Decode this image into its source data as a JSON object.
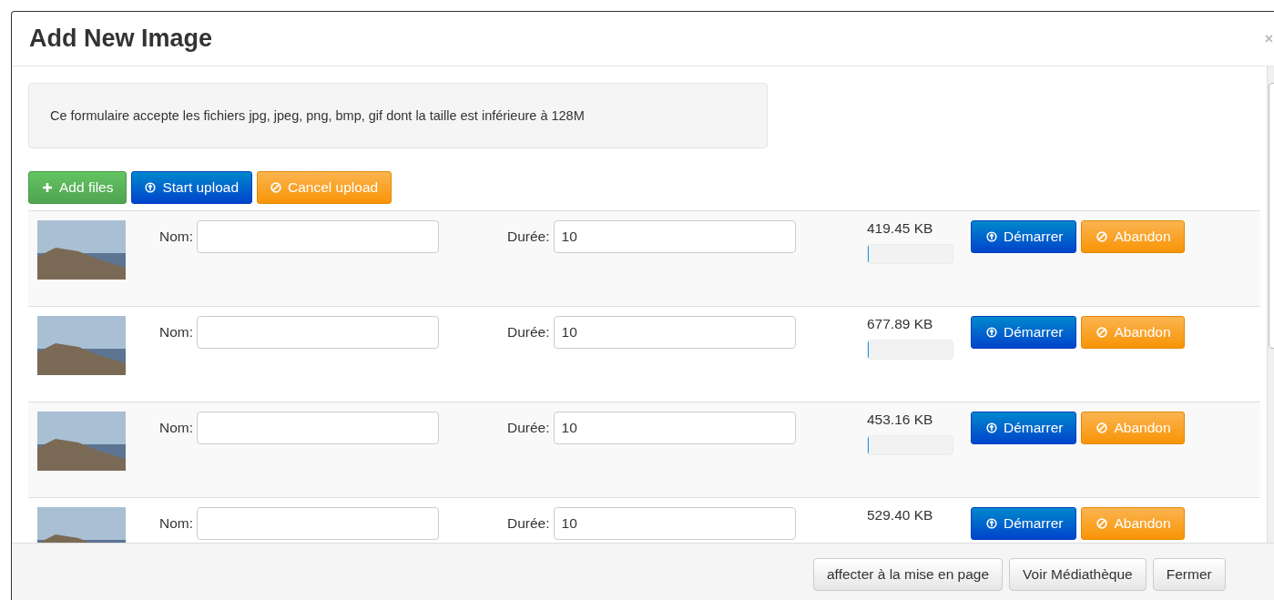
{
  "dialog": {
    "title": "Add New Image",
    "close": "×"
  },
  "notice": "Ce formulaire accepte les fichiers jpg, jpeg, png, bmp, gif dont la taille est inférieure à 128M",
  "toolbar": [
    {
      "label": "Add files",
      "kind": "add"
    },
    {
      "label": "Start upload",
      "kind": "start"
    },
    {
      "label": "Cancel upload",
      "kind": "cancel"
    }
  ],
  "files": [
    {
      "name_label": "Nom:",
      "duration_label": "Durée:",
      "duration_value": "10",
      "size": "419.45 KB",
      "progress": {
        "level": 0
      },
      "start_label": "Démarrer",
      "cancel_label": "Abandon"
    },
    {
      "name_label": "Nom:",
      "duration_label": "Durée:",
      "duration_value": "10",
      "size": "677.89 KB",
      "progress": {
        "level": 0
      },
      "start_label": "Démarrer",
      "cancel_label": "Abandon"
    },
    {
      "name_label": "Nom:",
      "duration_label": "Durée:",
      "duration_value": "10",
      "size": "453.16 KB",
      "progress": {
        "level": 0
      },
      "start_label": "Démarrer",
      "cancel_label": "Abandon"
    },
    {
      "name_label": "Nom:",
      "duration_label": "Durée:",
      "duration_value": "10",
      "size": "529.40 KB",
      "start_label": "Démarrer",
      "cancel_label": "Abandon"
    }
  ],
  "footer": [
    "affecter à la mise en page",
    "Voir Médiathèque",
    "Fermer"
  ]
}
